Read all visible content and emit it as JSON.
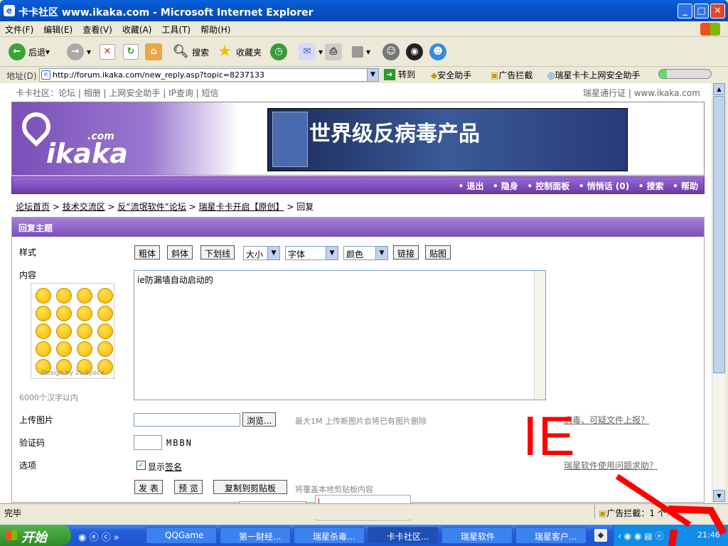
{
  "window": {
    "title": "卡卡社区 www.ikaka.com - Microsoft Internet Explorer"
  },
  "menu": [
    "文件(F)",
    "编辑(E)",
    "查看(V)",
    "收藏(A)",
    "工具(T)",
    "帮助(H)"
  ],
  "toolbar": {
    "back": "后退",
    "search": "搜索",
    "favorites": "收藏夹"
  },
  "address": {
    "label": "地址(D)",
    "url": "http://forum.ikaka.com/new_reply.asp?topic=8237133",
    "go": "转到",
    "security_helper": "安全助手",
    "ad_block": "广告拦截",
    "rising_helper": "瑞星卡卡上网安全助手"
  },
  "site": {
    "top_links": [
      "卡卡社区：论坛",
      "相册",
      "上网安全助手",
      "IP查询",
      "短信"
    ],
    "top_right": [
      "瑞星通行证",
      "www.ikaka.com"
    ],
    "logo_text": "ikaka",
    "logo_com": ".com",
    "banner_text": "世界级反病毒产品",
    "nav": [
      "• 退出",
      "• 隐身",
      "• 控制面板",
      "• 悄悄话 (0)",
      "• 搜索",
      "• 帮助"
    ],
    "breadcrumb": [
      "论坛首页",
      "技术交流区",
      "反“流氓软件”论坛",
      "瑞星卡卡开启【原创】"
    ],
    "breadcrumb_current": "回复"
  },
  "form": {
    "section_title": "回复主题",
    "style_label": "样式",
    "style_buttons": [
      "粗体",
      "斜体",
      "下划线"
    ],
    "size_select": "大小",
    "font_select": "字体",
    "color_select": "颜色",
    "link_button": "链接",
    "image_button": "贴图",
    "content_label": "内容",
    "content_value": "ie防漏墙自动启动的",
    "emoticon_credit": "Design by 2s-Space",
    "char_limit": "6000个汉字以内",
    "upload_label": "上传图片",
    "browse_button": "浏览...",
    "upload_hint": "最大1M 上传新图片会将已有图片删除",
    "captcha_label": "验证码",
    "captcha_value": "MBBN",
    "options_label": "选项",
    "show_signature_prefix": "显示",
    "show_signature_link": "签名",
    "submit_button": "发 表",
    "preview_button": "预 览",
    "copy_button": "复制到剪贴板",
    "copy_hint": "将覆盖本地剪贴板内容",
    "side_link1": "病毒、可疑文件上报？",
    "side_link2": "瑞星软件使用问题求助？"
  },
  "annotation_text": "IE",
  "status": {
    "text": "完毕",
    "ad_block": "广告拦截：1 个"
  },
  "taskbar": {
    "start": "开始",
    "tasks": [
      "QQGame",
      "第一财经...",
      "瑞星杀毒...",
      "卡卡社区...",
      "瑞星软件",
      "瑞星客户..."
    ],
    "clock": "21:46"
  },
  "colors": {
    "purple": "#7a4fb8",
    "xp_blue": "#0a5fd8",
    "annotation_red": "#ff0000"
  }
}
